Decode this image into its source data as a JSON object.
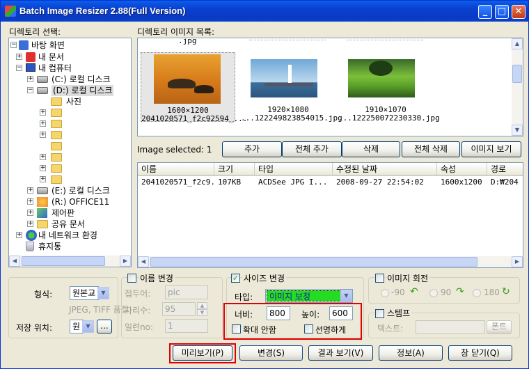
{
  "window": {
    "title": "Batch Image Resizer 2.88(Full Version)",
    "minimize": "_",
    "maximize": "□",
    "close": "✕"
  },
  "tree": {
    "label": "디렉토리 선택:",
    "items": [
      "바탕 화면",
      "내 문서",
      "내 컴퓨터",
      "(C:) 로컬 디스크",
      "(D:) 로컬 디스크",
      "사진",
      "(E:) 로컬 디스크",
      "(R:) OFFICE11",
      "제어판",
      "공유 문서",
      "내 네트워크 환경",
      "휴지통"
    ]
  },
  "images": {
    "label": "디렉토리 이미지 목록:",
    "thumbnails": [
      {
        "top": ".jpg",
        "size": "1600×1200",
        "name": "2041020571_f2c92594_..."
      },
      {
        "size": "1920×1080",
        "name": "...122249823854015.jpg"
      },
      {
        "size": "1910×1070",
        "name": "...122250072230330.jpg"
      }
    ]
  },
  "selection": {
    "label": "Image selected: 1"
  },
  "actions": {
    "add": "추가",
    "add_all": "전체 추가",
    "remove": "삭제",
    "remove_all": "전체 삭제",
    "view_image": "이미지 보기"
  },
  "table": {
    "columns": [
      "이름",
      "크기",
      "타입",
      "수정된 날짜",
      "속성",
      "경로"
    ],
    "rows": [
      [
        "2041020571_f2c9...",
        "107KB",
        "ACDSee JPG I...",
        "2008-09-27 22:54:02",
        "1600x1200",
        "D:₩204"
      ]
    ]
  },
  "format": {
    "label": "형식:",
    "value": "원본교",
    "note": "JPEG, TIFF 품질",
    "save_label": "저장 위치:",
    "save_value": "원",
    "browse": "..."
  },
  "rename": {
    "title": "이름 변경",
    "prefix_label": "접두어:",
    "prefix_value": "pic",
    "digits_label": "자리수:",
    "digits_value": "95",
    "serial_label": "일련no:",
    "serial_value": "1"
  },
  "resize": {
    "title": "사이즈 변경",
    "type_label": "타입:",
    "type_value": "이미지 보정",
    "width_label": "너비:",
    "width_value": "800",
    "height_label": "높이:",
    "height_value": "600",
    "no_enlarge": "확대 안함",
    "sharpen": "선명하게"
  },
  "rotate": {
    "title": "이미지 회전",
    "opt1": "-90",
    "opt2": "90",
    "opt3": "180"
  },
  "stamp": {
    "title": "스템프",
    "text_label": "텍스트:",
    "font_button": "폰트"
  },
  "bottom": {
    "preview": "미리보기(P)",
    "convert": "변경(S)",
    "view_result": "결과 보기(V)",
    "info": "정보(A)",
    "close": "창 닫기(Q)"
  },
  "colors": {
    "titlebar": "#0a3fd0",
    "highlight": "#e00000",
    "combo_green": "#22dd22"
  }
}
